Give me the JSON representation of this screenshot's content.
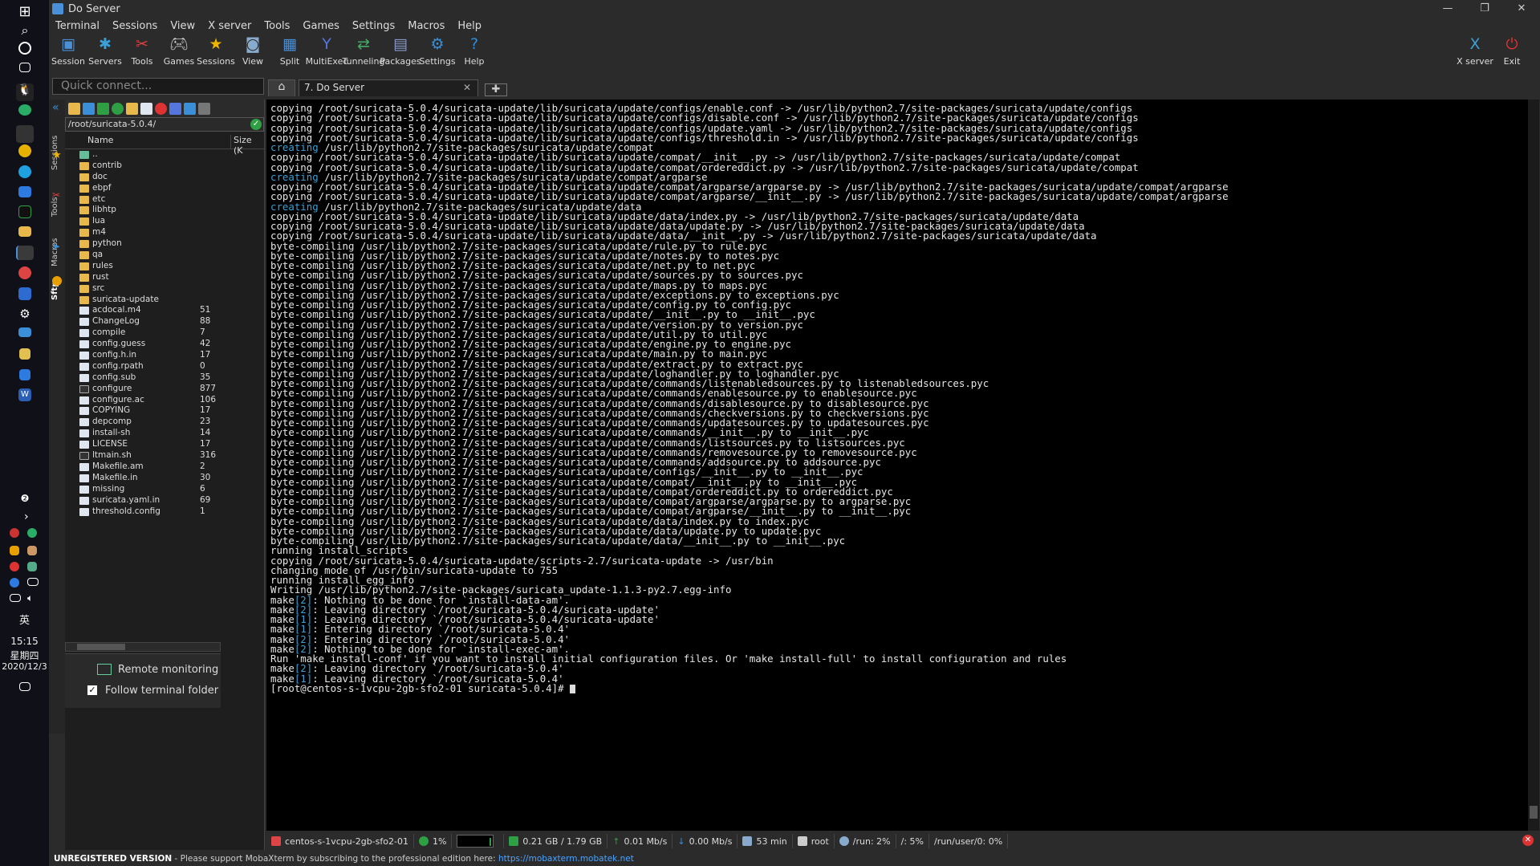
{
  "window": {
    "title": "Do Server",
    "controls": [
      "—",
      "❐",
      "✕"
    ]
  },
  "taskbar": {
    "ime": "英",
    "time": "15:15",
    "weekday": "星期四",
    "date": "2020/12/3"
  },
  "menu": [
    "Terminal",
    "Sessions",
    "View",
    "X server",
    "Tools",
    "Games",
    "Settings",
    "Macros",
    "Help"
  ],
  "toolbar": [
    {
      "label": "Session",
      "icon": "session-icon",
      "color": "#4a90d9"
    },
    {
      "label": "Servers",
      "icon": "servers-icon",
      "color": "#3aa0d8"
    },
    {
      "label": "Tools",
      "icon": "tools-icon",
      "color": "#e04040"
    },
    {
      "label": "Games",
      "icon": "games-icon",
      "color": "#cccccc"
    },
    {
      "label": "Sessions",
      "icon": "star-icon",
      "color": "#f0b400"
    },
    {
      "label": "View",
      "icon": "view-icon",
      "color": "#88aacc"
    },
    {
      "label": "Split",
      "icon": "split-icon",
      "color": "#4a90d9"
    },
    {
      "label": "MultiExec",
      "icon": "multiexec-icon",
      "color": "#5577dd"
    },
    {
      "label": "Tunneling",
      "icon": "tunneling-icon",
      "color": "#44aa66"
    },
    {
      "label": "Packages",
      "icon": "packages-icon",
      "color": "#8899cc"
    },
    {
      "label": "Settings",
      "icon": "settings-icon",
      "color": "#3a8fd8"
    },
    {
      "label": "Help",
      "icon": "help-icon",
      "color": "#2a8de0"
    }
  ],
  "toolbar_right": [
    {
      "label": "X server",
      "icon": "xserver-icon",
      "color": "#3aa0d8"
    },
    {
      "label": "Exit",
      "icon": "exit-icon",
      "color": "#e03030"
    }
  ],
  "quick_connect": {
    "placeholder": "Quick connect..."
  },
  "tab": {
    "label": "7. Do Server"
  },
  "side_tabs": [
    "Sessions",
    "Tools",
    "Macros",
    "Sftp"
  ],
  "sftp": {
    "path": "/root/suricata-5.0.4/",
    "columns": [
      "Name",
      "Size (K"
    ],
    "files": [
      {
        "name": "..",
        "size": "",
        "type": "up"
      },
      {
        "name": "contrib",
        "size": "",
        "type": "folder"
      },
      {
        "name": "doc",
        "size": "",
        "type": "folder"
      },
      {
        "name": "ebpf",
        "size": "",
        "type": "folder"
      },
      {
        "name": "etc",
        "size": "",
        "type": "folder"
      },
      {
        "name": "libhtp",
        "size": "",
        "type": "folder"
      },
      {
        "name": "lua",
        "size": "",
        "type": "folder"
      },
      {
        "name": "m4",
        "size": "",
        "type": "folder"
      },
      {
        "name": "python",
        "size": "",
        "type": "folder"
      },
      {
        "name": "qa",
        "size": "",
        "type": "folder"
      },
      {
        "name": "rules",
        "size": "",
        "type": "folder"
      },
      {
        "name": "rust",
        "size": "",
        "type": "folder"
      },
      {
        "name": "src",
        "size": "",
        "type": "folder"
      },
      {
        "name": "suricata-update",
        "size": "",
        "type": "folder"
      },
      {
        "name": "acdocal.m4",
        "size": "51",
        "type": "file"
      },
      {
        "name": "ChangeLog",
        "size": "88",
        "type": "file"
      },
      {
        "name": "compile",
        "size": "7",
        "type": "file"
      },
      {
        "name": "config.guess",
        "size": "42",
        "type": "file"
      },
      {
        "name": "config.h.in",
        "size": "17",
        "type": "file"
      },
      {
        "name": "config.rpath",
        "size": "0",
        "type": "file"
      },
      {
        "name": "config.sub",
        "size": "35",
        "type": "file"
      },
      {
        "name": "configure",
        "size": "877",
        "type": "exec"
      },
      {
        "name": "configure.ac",
        "size": "106",
        "type": "file"
      },
      {
        "name": "COPYING",
        "size": "17",
        "type": "file"
      },
      {
        "name": "depcomp",
        "size": "23",
        "type": "file"
      },
      {
        "name": "install-sh",
        "size": "14",
        "type": "file"
      },
      {
        "name": "LICENSE",
        "size": "17",
        "type": "file"
      },
      {
        "name": "ltmain.sh",
        "size": "316",
        "type": "exec"
      },
      {
        "name": "Makefile.am",
        "size": "2",
        "type": "file"
      },
      {
        "name": "Makefile.in",
        "size": "30",
        "type": "file"
      },
      {
        "name": "missing",
        "size": "6",
        "type": "file"
      },
      {
        "name": "suricata.yaml.in",
        "size": "69",
        "type": "file"
      },
      {
        "name": "threshold.config",
        "size": "1",
        "type": "file"
      }
    ],
    "remote_monitoring": "Remote monitoring",
    "follow_terminal": "Follow terminal folder"
  },
  "terminal": {
    "lines": [
      "copying /root/suricata-5.0.4/suricata-update/lib/suricata/update/configs/enable.conf -> /usr/lib/python2.7/site-packages/suricata/update/configs",
      "copying /root/suricata-5.0.4/suricata-update/lib/suricata/update/configs/disable.conf -> /usr/lib/python2.7/site-packages/suricata/update/configs",
      "copying /root/suricata-5.0.4/suricata-update/lib/suricata/update/configs/update.yaml -> /usr/lib/python2.7/site-packages/suricata/update/configs",
      "copying /root/suricata-5.0.4/suricata-update/lib/suricata/update/configs/threshold.in -> /usr/lib/python2.7/site-packages/suricata/update/configs",
      "creating /usr/lib/python2.7/site-packages/suricata/update/compat",
      "copying /root/suricata-5.0.4/suricata-update/lib/suricata/update/compat/__init__.py -> /usr/lib/python2.7/site-packages/suricata/update/compat",
      "copying /root/suricata-5.0.4/suricata-update/lib/suricata/update/compat/ordereddict.py -> /usr/lib/python2.7/site-packages/suricata/update/compat",
      "creating /usr/lib/python2.7/site-packages/suricata/update/compat/argparse",
      "copying /root/suricata-5.0.4/suricata-update/lib/suricata/update/compat/argparse/argparse.py -> /usr/lib/python2.7/site-packages/suricata/update/compat/argparse",
      "copying /root/suricata-5.0.4/suricata-update/lib/suricata/update/compat/argparse/__init__.py -> /usr/lib/python2.7/site-packages/suricata/update/compat/argparse",
      "creating /usr/lib/python2.7/site-packages/suricata/update/data",
      "copying /root/suricata-5.0.4/suricata-update/lib/suricata/update/data/index.py -> /usr/lib/python2.7/site-packages/suricata/update/data",
      "copying /root/suricata-5.0.4/suricata-update/lib/suricata/update/data/update.py -> /usr/lib/python2.7/site-packages/suricata/update/data",
      "copying /root/suricata-5.0.4/suricata-update/lib/suricata/update/data/__init__.py -> /usr/lib/python2.7/site-packages/suricata/update/data",
      "byte-compiling /usr/lib/python2.7/site-packages/suricata/update/rule.py to rule.pyc",
      "byte-compiling /usr/lib/python2.7/site-packages/suricata/update/notes.py to notes.pyc",
      "byte-compiling /usr/lib/python2.7/site-packages/suricata/update/net.py to net.pyc",
      "byte-compiling /usr/lib/python2.7/site-packages/suricata/update/sources.py to sources.pyc",
      "byte-compiling /usr/lib/python2.7/site-packages/suricata/update/maps.py to maps.pyc",
      "byte-compiling /usr/lib/python2.7/site-packages/suricata/update/exceptions.py to exceptions.pyc",
      "byte-compiling /usr/lib/python2.7/site-packages/suricata/update/config.py to config.pyc",
      "byte-compiling /usr/lib/python2.7/site-packages/suricata/update/__init__.py to __init__.pyc",
      "byte-compiling /usr/lib/python2.7/site-packages/suricata/update/version.py to version.pyc",
      "byte-compiling /usr/lib/python2.7/site-packages/suricata/update/util.py to util.pyc",
      "byte-compiling /usr/lib/python2.7/site-packages/suricata/update/engine.py to engine.pyc",
      "byte-compiling /usr/lib/python2.7/site-packages/suricata/update/main.py to main.pyc",
      "byte-compiling /usr/lib/python2.7/site-packages/suricata/update/extract.py to extract.pyc",
      "byte-compiling /usr/lib/python2.7/site-packages/suricata/update/loghandler.py to loghandler.pyc",
      "byte-compiling /usr/lib/python2.7/site-packages/suricata/update/commands/listenabledsources.py to listenabledsources.pyc",
      "byte-compiling /usr/lib/python2.7/site-packages/suricata/update/commands/enablesource.py to enablesource.pyc",
      "byte-compiling /usr/lib/python2.7/site-packages/suricata/update/commands/disablesource.py to disablesource.pyc",
      "byte-compiling /usr/lib/python2.7/site-packages/suricata/update/commands/checkversions.py to checkversions.pyc",
      "byte-compiling /usr/lib/python2.7/site-packages/suricata/update/commands/updatesources.py to updatesources.pyc",
      "byte-compiling /usr/lib/python2.7/site-packages/suricata/update/commands/__init__.py to __init__.pyc",
      "byte-compiling /usr/lib/python2.7/site-packages/suricata/update/commands/listsources.py to listsources.pyc",
      "byte-compiling /usr/lib/python2.7/site-packages/suricata/update/commands/removesource.py to removesource.pyc",
      "byte-compiling /usr/lib/python2.7/site-packages/suricata/update/commands/addsource.py to addsource.pyc",
      "byte-compiling /usr/lib/python2.7/site-packages/suricata/update/configs/__init__.py to __init__.pyc",
      "byte-compiling /usr/lib/python2.7/site-packages/suricata/update/compat/__init__.py to __init__.pyc",
      "byte-compiling /usr/lib/python2.7/site-packages/suricata/update/compat/ordereddict.py to ordereddict.pyc",
      "byte-compiling /usr/lib/python2.7/site-packages/suricata/update/compat/argparse/argparse.py to argparse.pyc",
      "byte-compiling /usr/lib/python2.7/site-packages/suricata/update/compat/argparse/__init__.py to __init__.pyc",
      "byte-compiling /usr/lib/python2.7/site-packages/suricata/update/data/index.py to index.pyc",
      "byte-compiling /usr/lib/python2.7/site-packages/suricata/update/data/update.py to update.pyc",
      "byte-compiling /usr/lib/python2.7/site-packages/suricata/update/data/__init__.py to __init__.pyc",
      "running install_scripts",
      "copying /root/suricata-5.0.4/suricata-update/scripts-2.7/suricata-update -> /usr/bin",
      "changing mode of /usr/bin/suricata-update to 755",
      "running install_egg_info",
      "Writing /usr/lib/python2.7/site-packages/suricata_update-1.1.3-py2.7.egg-info",
      "make[2]: Nothing to be done for `install-data-am'.",
      "make[2]: Leaving directory `/root/suricata-5.0.4/suricata-update'",
      "make[1]: Leaving directory `/root/suricata-5.0.4/suricata-update'",
      "make[1]: Entering directory `/root/suricata-5.0.4'",
      "make[2]: Entering directory `/root/suricata-5.0.4'",
      "make[2]: Nothing to be done for `install-exec-am'.",
      "Run 'make install-conf' if you want to install initial configuration files. Or 'make install-full' to install configuration and rules",
      "make[2]: Leaving directory `/root/suricata-5.0.4'",
      "make[1]: Leaving directory `/root/suricata-5.0.4'"
    ],
    "prompt": "[root@centos-s-1vcpu-2gb-sfo2-01 suricata-5.0.4]# "
  },
  "status": {
    "host": "centos-s-1vcpu-2gb-sfo2-01",
    "cpu": "1%",
    "memory": "0.21 GB / 1.79 GB",
    "upload": "0.01 Mb/s",
    "download": "0.00 Mb/s",
    "uptime": "53 min",
    "user": "root",
    "disk_run": "/run: 2%",
    "disk_root": "/: 5%",
    "disk_user": "/run/user/0: 0%"
  },
  "footer": {
    "unregistered": "UNREGISTERED VERSION",
    "message": " -  Please support MobaXterm by subscribing to the professional edition here: ",
    "link": "https://mobaxterm.mobatek.net"
  }
}
